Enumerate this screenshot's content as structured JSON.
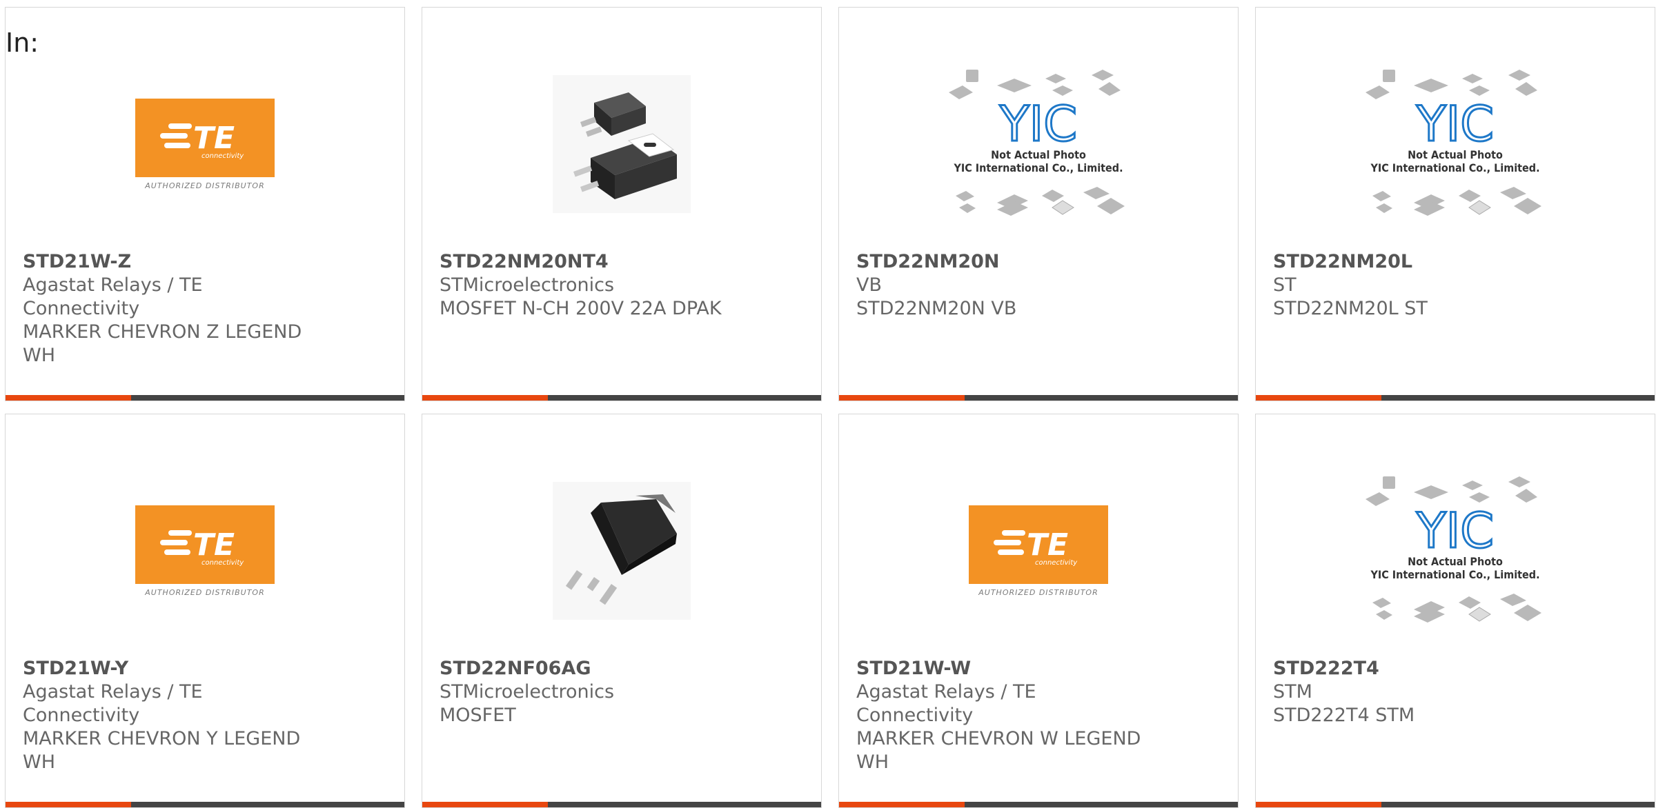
{
  "header": {
    "label": "In:"
  },
  "colors": {
    "accent": "#e8470f",
    "bar": "#444444",
    "te_orange": "#f39224"
  },
  "products": [
    {
      "part_number": "STD21W-Z",
      "manufacturer": "Agastat Relays / TE Connectivity",
      "description": "MARKER CHEVRON Z LEGEND WH",
      "image": "te-connectivity-logo"
    },
    {
      "part_number": "STD22NM20NT4",
      "manufacturer": "STMicroelectronics",
      "description": "MOSFET N-CH 200V 22A DPAK",
      "image": "dpak-package-photo"
    },
    {
      "part_number": "STD22NM20N",
      "manufacturer": "VB",
      "description": "STD22NM20N VB",
      "image": "yic-placeholder"
    },
    {
      "part_number": "STD22NM20L",
      "manufacturer": "ST",
      "description": "STD22NM20L ST",
      "image": "yic-placeholder"
    },
    {
      "part_number": "STD21W-Y",
      "manufacturer": "Agastat Relays / TE Connectivity",
      "description": "MARKER CHEVRON Y LEGEND WH",
      "image": "te-connectivity-logo"
    },
    {
      "part_number": "STD22NF06AG",
      "manufacturer": "STMicroelectronics",
      "description": "MOSFET",
      "image": "dpak-single-photo"
    },
    {
      "part_number": "STD21W-W",
      "manufacturer": "Agastat Relays / TE Connectivity",
      "description": "MARKER CHEVRON W LEGEND WH",
      "image": "te-connectivity-logo"
    },
    {
      "part_number": "STD222T4",
      "manufacturer": "STM",
      "description": "STD222T4 STM",
      "image": "yic-placeholder"
    }
  ],
  "te_logo": {
    "mark": "TE",
    "sub": "connectivity",
    "caption": "AUTHORIZED DISTRIBUTOR"
  },
  "yic_placeholder": {
    "mark": "YIC",
    "line1": "Not Actual Photo",
    "line2": "YIC International Co., Limited."
  }
}
